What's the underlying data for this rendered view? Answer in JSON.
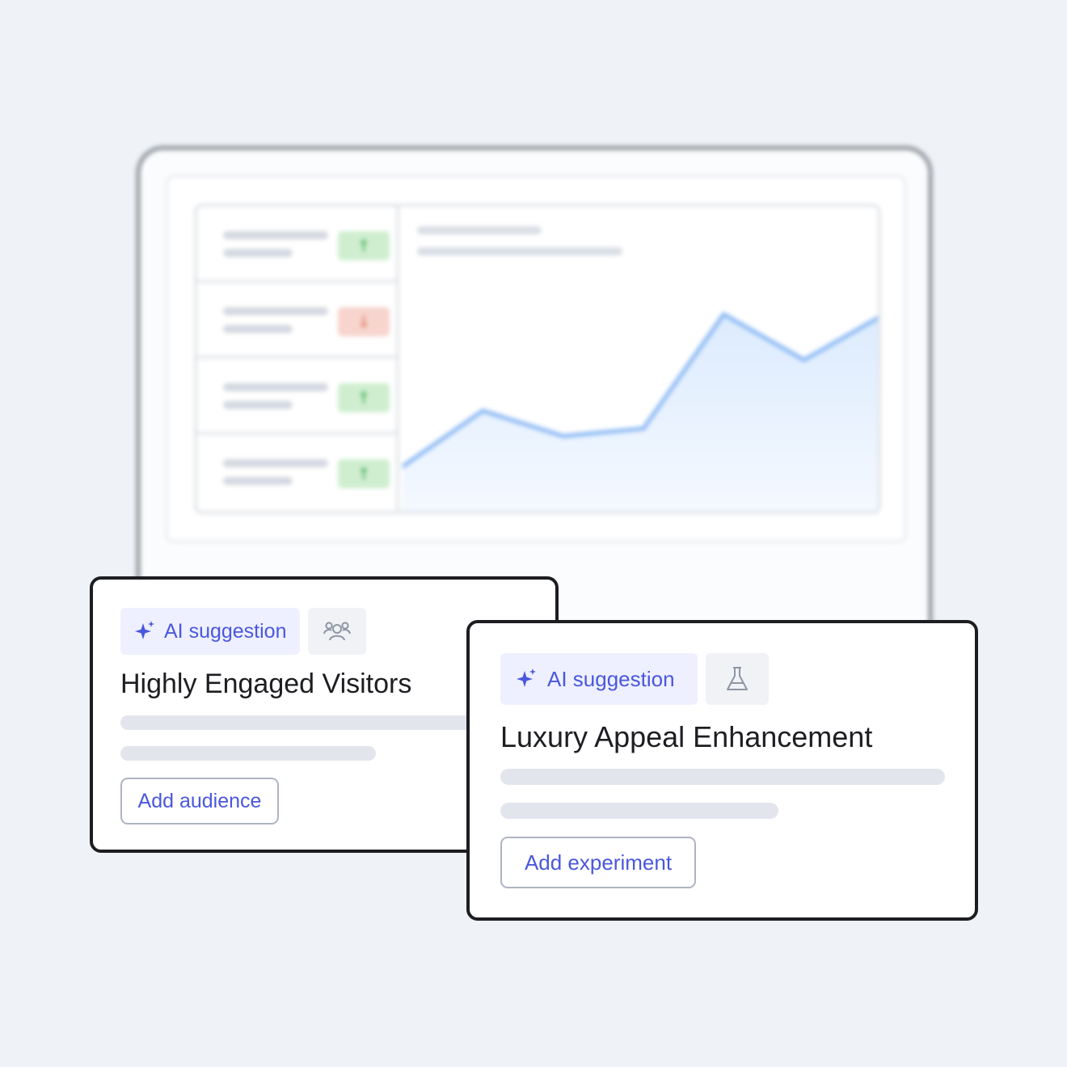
{
  "dashboard": {
    "rows": [
      {
        "trend": "up",
        "icon": "arrow-up-icon",
        "glyph": "↑",
        "color": "#57b463"
      },
      {
        "trend": "down",
        "icon": "arrow-down-icon",
        "glyph": "↓",
        "color": "#e38a76"
      },
      {
        "trend": "up",
        "icon": "arrow-up-icon",
        "glyph": "↑",
        "color": "#57b463"
      },
      {
        "trend": "up",
        "icon": "arrow-up-icon",
        "glyph": "↑",
        "color": "#57b463"
      }
    ]
  },
  "chart_data": {
    "type": "area",
    "x": [
      0,
      1,
      2,
      3,
      4,
      5,
      6
    ],
    "values": [
      0.2,
      0.42,
      0.32,
      0.35,
      0.8,
      0.62,
      0.8
    ],
    "ylim": [
      0,
      1
    ],
    "grid": false,
    "color": "#8ab8f3"
  },
  "cards": {
    "audience": {
      "chip_label": "AI suggestion",
      "chip_icon": "sparkle-icon",
      "type_icon": "users-icon",
      "title": "Highly Engaged Visitors",
      "button_label": "Add audience"
    },
    "experiment": {
      "chip_label": "AI suggestion",
      "chip_icon": "sparkle-icon",
      "type_icon": "flask-icon",
      "title": "Luxury Appeal Enhancement",
      "button_label": "Add experiment"
    }
  },
  "colors": {
    "accent": "#4a57dd",
    "background": "#eff3f7",
    "chip_bg": "#eef0ff",
    "up": "#57b463",
    "down": "#e38a76"
  }
}
